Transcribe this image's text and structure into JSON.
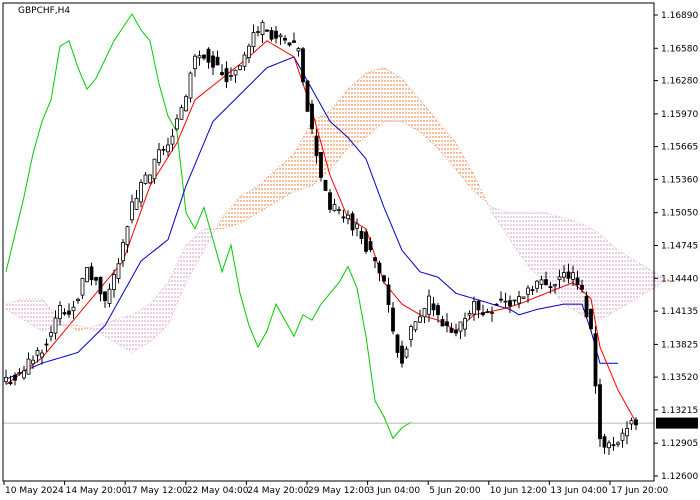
{
  "chart_data": {
    "type": "candlestick",
    "symbol_label": "GBPCHF,H4",
    "current_price": "1.13092",
    "y_ticks": [
      "1.16890",
      "1.16580",
      "1.16280",
      "1.15970",
      "1.15665",
      "1.15360",
      "1.15050",
      "1.14745",
      "1.14440",
      "1.14135",
      "1.13825",
      "1.13520",
      "1.13215",
      "1.12905",
      "1.12600"
    ],
    "x_ticks": [
      "10 May 2024",
      "14 May 20:00",
      "17 May 12:00",
      "22 May 04:00",
      "24 May 20:00",
      "29 May 12:00",
      "3 Jun 04:00",
      "5 Jun 20:00",
      "10 Jun 12:00",
      "13 Jun 04:00",
      "17 Jun 20:00"
    ],
    "ylim": [
      1.126,
      1.1705
    ],
    "grid": false,
    "colors": {
      "background": "#ffffff",
      "candle": "#000000",
      "tenkan": "#ff0000",
      "kijun": "#0000cc",
      "chikou": "#00cc00",
      "kumo_bull": "#f08040",
      "kumo_bear": "#d8a0c8",
      "price_line": "#a0a0a0",
      "price_box": "#000000",
      "price_box_text": "#ffffff"
    },
    "price_keypoints": [
      [
        0,
        1.135
      ],
      [
        3,
        1.1352
      ],
      [
        5,
        1.1365
      ],
      [
        8,
        1.138
      ],
      [
        10,
        1.1395
      ],
      [
        12,
        1.1415
      ],
      [
        14,
        1.1412
      ],
      [
        16,
        1.143
      ],
      [
        18,
        1.145
      ],
      [
        20,
        1.144
      ],
      [
        22,
        1.142
      ],
      [
        24,
        1.1445
      ],
      [
        26,
        1.148
      ],
      [
        28,
        1.151
      ],
      [
        30,
        1.153
      ],
      [
        32,
        1.154
      ],
      [
        34,
        1.156
      ],
      [
        36,
        1.157
      ],
      [
        38,
        1.159
      ],
      [
        40,
        1.161
      ],
      [
        41,
        1.164
      ],
      [
        43,
        1.1655
      ],
      [
        45,
        1.165
      ],
      [
        47,
        1.164
      ],
      [
        49,
        1.163
      ],
      [
        51,
        1.164
      ],
      [
        53,
        1.165
      ],
      [
        55,
        1.167
      ],
      [
        57,
        1.168
      ],
      [
        59,
        1.167
      ],
      [
        61,
        1.1665
      ],
      [
        63,
        1.166
      ],
      [
        65,
        1.1655
      ],
      [
        66,
        1.1625
      ],
      [
        68,
        1.158
      ],
      [
        70,
        1.154
      ],
      [
        72,
        1.151
      ],
      [
        74,
        1.1505
      ],
      [
        76,
        1.15
      ],
      [
        78,
        1.149
      ],
      [
        80,
        1.1475
      ],
      [
        82,
        1.146
      ],
      [
        84,
        1.144
      ],
      [
        86,
        1.139
      ],
      [
        88,
        1.137
      ],
      [
        90,
        1.1395
      ],
      [
        92,
        1.1405
      ],
      [
        94,
        1.1425
      ],
      [
        96,
        1.1405
      ],
      [
        98,
        1.1395
      ],
      [
        100,
        1.139
      ],
      [
        102,
        1.141
      ],
      [
        104,
        1.142
      ],
      [
        106,
        1.141
      ],
      [
        108,
        1.1418
      ],
      [
        110,
        1.1425
      ],
      [
        112,
        1.142
      ],
      [
        114,
        1.1425
      ],
      [
        116,
        1.1435
      ],
      [
        118,
        1.144
      ],
      [
        120,
        1.1438
      ],
      [
        122,
        1.1442
      ],
      [
        124,
        1.1448
      ],
      [
        126,
        1.1445
      ],
      [
        128,
        1.143
      ],
      [
        130,
        1.1395
      ],
      [
        131,
        1.1345
      ],
      [
        132,
        1.13
      ],
      [
        133,
        1.1285
      ],
      [
        134,
        1.1288
      ],
      [
        136,
        1.1295
      ],
      [
        138,
        1.1305
      ],
      [
        140,
        1.131
      ]
    ],
    "tenkan_keypoints": [
      [
        0,
        1.1345
      ],
      [
        8,
        1.137
      ],
      [
        14,
        1.14
      ],
      [
        20,
        1.143
      ],
      [
        26,
        1.146
      ],
      [
        32,
        1.153
      ],
      [
        38,
        1.157
      ],
      [
        42,
        1.161
      ],
      [
        48,
        1.163
      ],
      [
        54,
        1.165
      ],
      [
        58,
        1.1665
      ],
      [
        64,
        1.165
      ],
      [
        68,
        1.16
      ],
      [
        72,
        1.154
      ],
      [
        76,
        1.15
      ],
      [
        80,
        1.149
      ],
      [
        84,
        1.144
      ],
      [
        88,
        1.142
      ],
      [
        92,
        1.141
      ],
      [
        96,
        1.1405
      ],
      [
        100,
        1.1395
      ],
      [
        104,
        1.141
      ],
      [
        110,
        1.1415
      ],
      [
        114,
        1.142
      ],
      [
        120,
        1.143
      ],
      [
        126,
        1.144
      ],
      [
        130,
        1.1425
      ],
      [
        132,
        1.138
      ],
      [
        136,
        1.134
      ],
      [
        140,
        1.131
      ]
    ],
    "kijun_keypoints": [
      [
        0,
        1.135
      ],
      [
        8,
        1.1365
      ],
      [
        16,
        1.1375
      ],
      [
        22,
        1.14
      ],
      [
        26,
        1.143
      ],
      [
        30,
        1.146
      ],
      [
        36,
        1.148
      ],
      [
        40,
        1.153
      ],
      [
        46,
        1.159
      ],
      [
        52,
        1.1615
      ],
      [
        58,
        1.164
      ],
      [
        64,
        1.165
      ],
      [
        68,
        1.162
      ],
      [
        72,
        1.159
      ],
      [
        76,
        1.1575
      ],
      [
        80,
        1.1555
      ],
      [
        84,
        1.151
      ],
      [
        88,
        1.147
      ],
      [
        92,
        1.145
      ],
      [
        96,
        1.1445
      ],
      [
        100,
        1.143
      ],
      [
        104,
        1.1425
      ],
      [
        108,
        1.142
      ],
      [
        112,
        1.1415
      ],
      [
        114,
        1.141
      ],
      [
        118,
        1.1415
      ],
      [
        124,
        1.142
      ],
      [
        128,
        1.142
      ],
      [
        130,
        1.1395
      ],
      [
        132,
        1.1365
      ],
      [
        136,
        1.1365
      ]
    ],
    "chikou_keypoints": [
      [
        0,
        1.145
      ],
      [
        4,
        1.152
      ],
      [
        6,
        1.156
      ],
      [
        8,
        1.159
      ],
      [
        10,
        1.161
      ],
      [
        12,
        1.166
      ],
      [
        14,
        1.1665
      ],
      [
        16,
        1.164
      ],
      [
        18,
        1.162
      ],
      [
        20,
        1.163
      ],
      [
        24,
        1.1665
      ],
      [
        28,
        1.169
      ],
      [
        30,
        1.1675
      ],
      [
        32,
        1.1665
      ],
      [
        34,
        1.1625
      ],
      [
        36,
        1.1595
      ],
      [
        38,
        1.158
      ],
      [
        40,
        1.1505
      ],
      [
        42,
        1.149
      ],
      [
        44,
        1.151
      ],
      [
        46,
        1.148
      ],
      [
        48,
        1.145
      ],
      [
        50,
        1.1475
      ],
      [
        52,
        1.143
      ],
      [
        54,
        1.14
      ],
      [
        56,
        1.138
      ],
      [
        58,
        1.1395
      ],
      [
        60,
        1.142
      ],
      [
        62,
        1.1405
      ],
      [
        64,
        1.139
      ],
      [
        66,
        1.141
      ],
      [
        68,
        1.1405
      ],
      [
        70,
        1.142
      ],
      [
        72,
        1.143
      ],
      [
        74,
        1.144
      ],
      [
        76,
        1.1455
      ],
      [
        78,
        1.1435
      ],
      [
        80,
        1.139
      ],
      [
        82,
        1.133
      ],
      [
        84,
        1.1315
      ],
      [
        86,
        1.1295
      ],
      [
        88,
        1.1305
      ],
      [
        90,
        1.131
      ]
    ],
    "senkou_a_keypoints": [
      [
        0,
        1.1415
      ],
      [
        4,
        1.1405
      ],
      [
        8,
        1.1395
      ],
      [
        12,
        1.14
      ],
      [
        16,
        1.14
      ],
      [
        20,
        1.1395
      ],
      [
        24,
        1.1385
      ],
      [
        28,
        1.1375
      ],
      [
        32,
        1.1385
      ],
      [
        36,
        1.14
      ],
      [
        40,
        1.144
      ],
      [
        44,
        1.147
      ],
      [
        48,
        1.15
      ],
      [
        52,
        1.152
      ],
      [
        56,
        1.153
      ],
      [
        60,
        1.1545
      ],
      [
        64,
        1.156
      ],
      [
        68,
        1.159
      ],
      [
        72,
        1.16
      ],
      [
        76,
        1.162
      ],
      [
        80,
        1.1635
      ],
      [
        84,
        1.164
      ],
      [
        88,
        1.163
      ],
      [
        92,
        1.161
      ],
      [
        96,
        1.159
      ],
      [
        100,
        1.157
      ],
      [
        104,
        1.154
      ],
      [
        108,
        1.1505
      ],
      [
        112,
        1.148
      ],
      [
        116,
        1.1455
      ],
      [
        120,
        1.144
      ],
      [
        124,
        1.142
      ],
      [
        128,
        1.141
      ],
      [
        132,
        1.1405
      ],
      [
        136,
        1.1415
      ],
      [
        140,
        1.1425
      ],
      [
        144,
        1.1435
      ],
      [
        148,
        1.1445
      ]
    ],
    "senkou_b_keypoints": [
      [
        0,
        1.142
      ],
      [
        4,
        1.1425
      ],
      [
        8,
        1.1425
      ],
      [
        12,
        1.1405
      ],
      [
        16,
        1.1395
      ],
      [
        20,
        1.14
      ],
      [
        24,
        1.1405
      ],
      [
        28,
        1.141
      ],
      [
        32,
        1.142
      ],
      [
        36,
        1.144
      ],
      [
        40,
        1.1475
      ],
      [
        44,
        1.149
      ],
      [
        48,
        1.149
      ],
      [
        52,
        1.1495
      ],
      [
        56,
        1.1505
      ],
      [
        60,
        1.1515
      ],
      [
        64,
        1.1525
      ],
      [
        68,
        1.153
      ],
      [
        72,
        1.1545
      ],
      [
        76,
        1.1565
      ],
      [
        80,
        1.1575
      ],
      [
        84,
        1.159
      ],
      [
        88,
        1.159
      ],
      [
        92,
        1.158
      ],
      [
        96,
        1.1565
      ],
      [
        100,
        1.1545
      ],
      [
        104,
        1.1525
      ],
      [
        108,
        1.151
      ],
      [
        112,
        1.1505
      ],
      [
        116,
        1.1505
      ],
      [
        120,
        1.1505
      ],
      [
        124,
        1.15
      ],
      [
        128,
        1.1495
      ],
      [
        132,
        1.1485
      ],
      [
        136,
        1.147
      ],
      [
        140,
        1.146
      ],
      [
        144,
        1.145
      ],
      [
        148,
        1.144
      ]
    ]
  }
}
